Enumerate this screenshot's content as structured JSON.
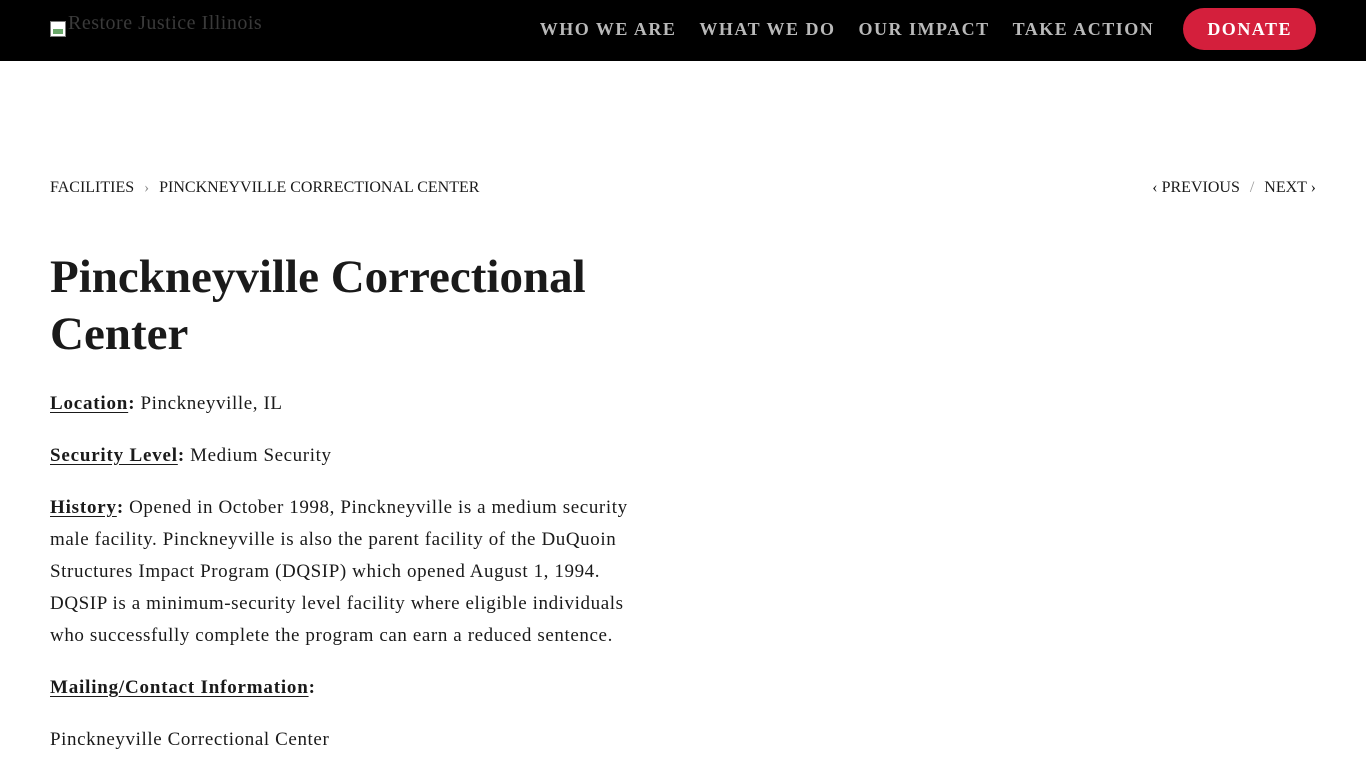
{
  "header": {
    "logo_alt": "Restore Justice Illinois",
    "nav": [
      "WHO WE ARE",
      "WHAT WE DO",
      "OUR IMPACT",
      "TAKE ACTION"
    ],
    "donate_label": "DONATE"
  },
  "breadcrumb": {
    "root": "FACILITIES",
    "separator": "›",
    "current": "PINCKNEYVILLE CORRECTIONAL CENTER"
  },
  "pager": {
    "previous": "‹ PREVIOUS",
    "slash": "/",
    "next": "NEXT ›"
  },
  "page": {
    "title": "Pinckneyville Correctional Center",
    "location_label": "Location",
    "location_value": "Pinckneyville, IL",
    "security_label": "Security Level",
    "security_value": "Medium Security",
    "history_label": "History",
    "history_value": "Opened in October 1998, Pinckneyville is a medium security male facility. Pinckneyville is also the parent facility of the DuQuoin Structures Impact Program (DQSIP) which opened August 1, 1994. DQSIP is a minimum-security level facility where eligible individuals who successfully complete the program can earn a reduced sentence.",
    "mailing_label": "Mailing/Contact Information",
    "mailing_first_line": "Pinckneyville Correctional Center"
  },
  "colors": {
    "topbar": "#000000",
    "nav_text": "#b9b9b9",
    "donate_bg": "#d41f3c"
  }
}
